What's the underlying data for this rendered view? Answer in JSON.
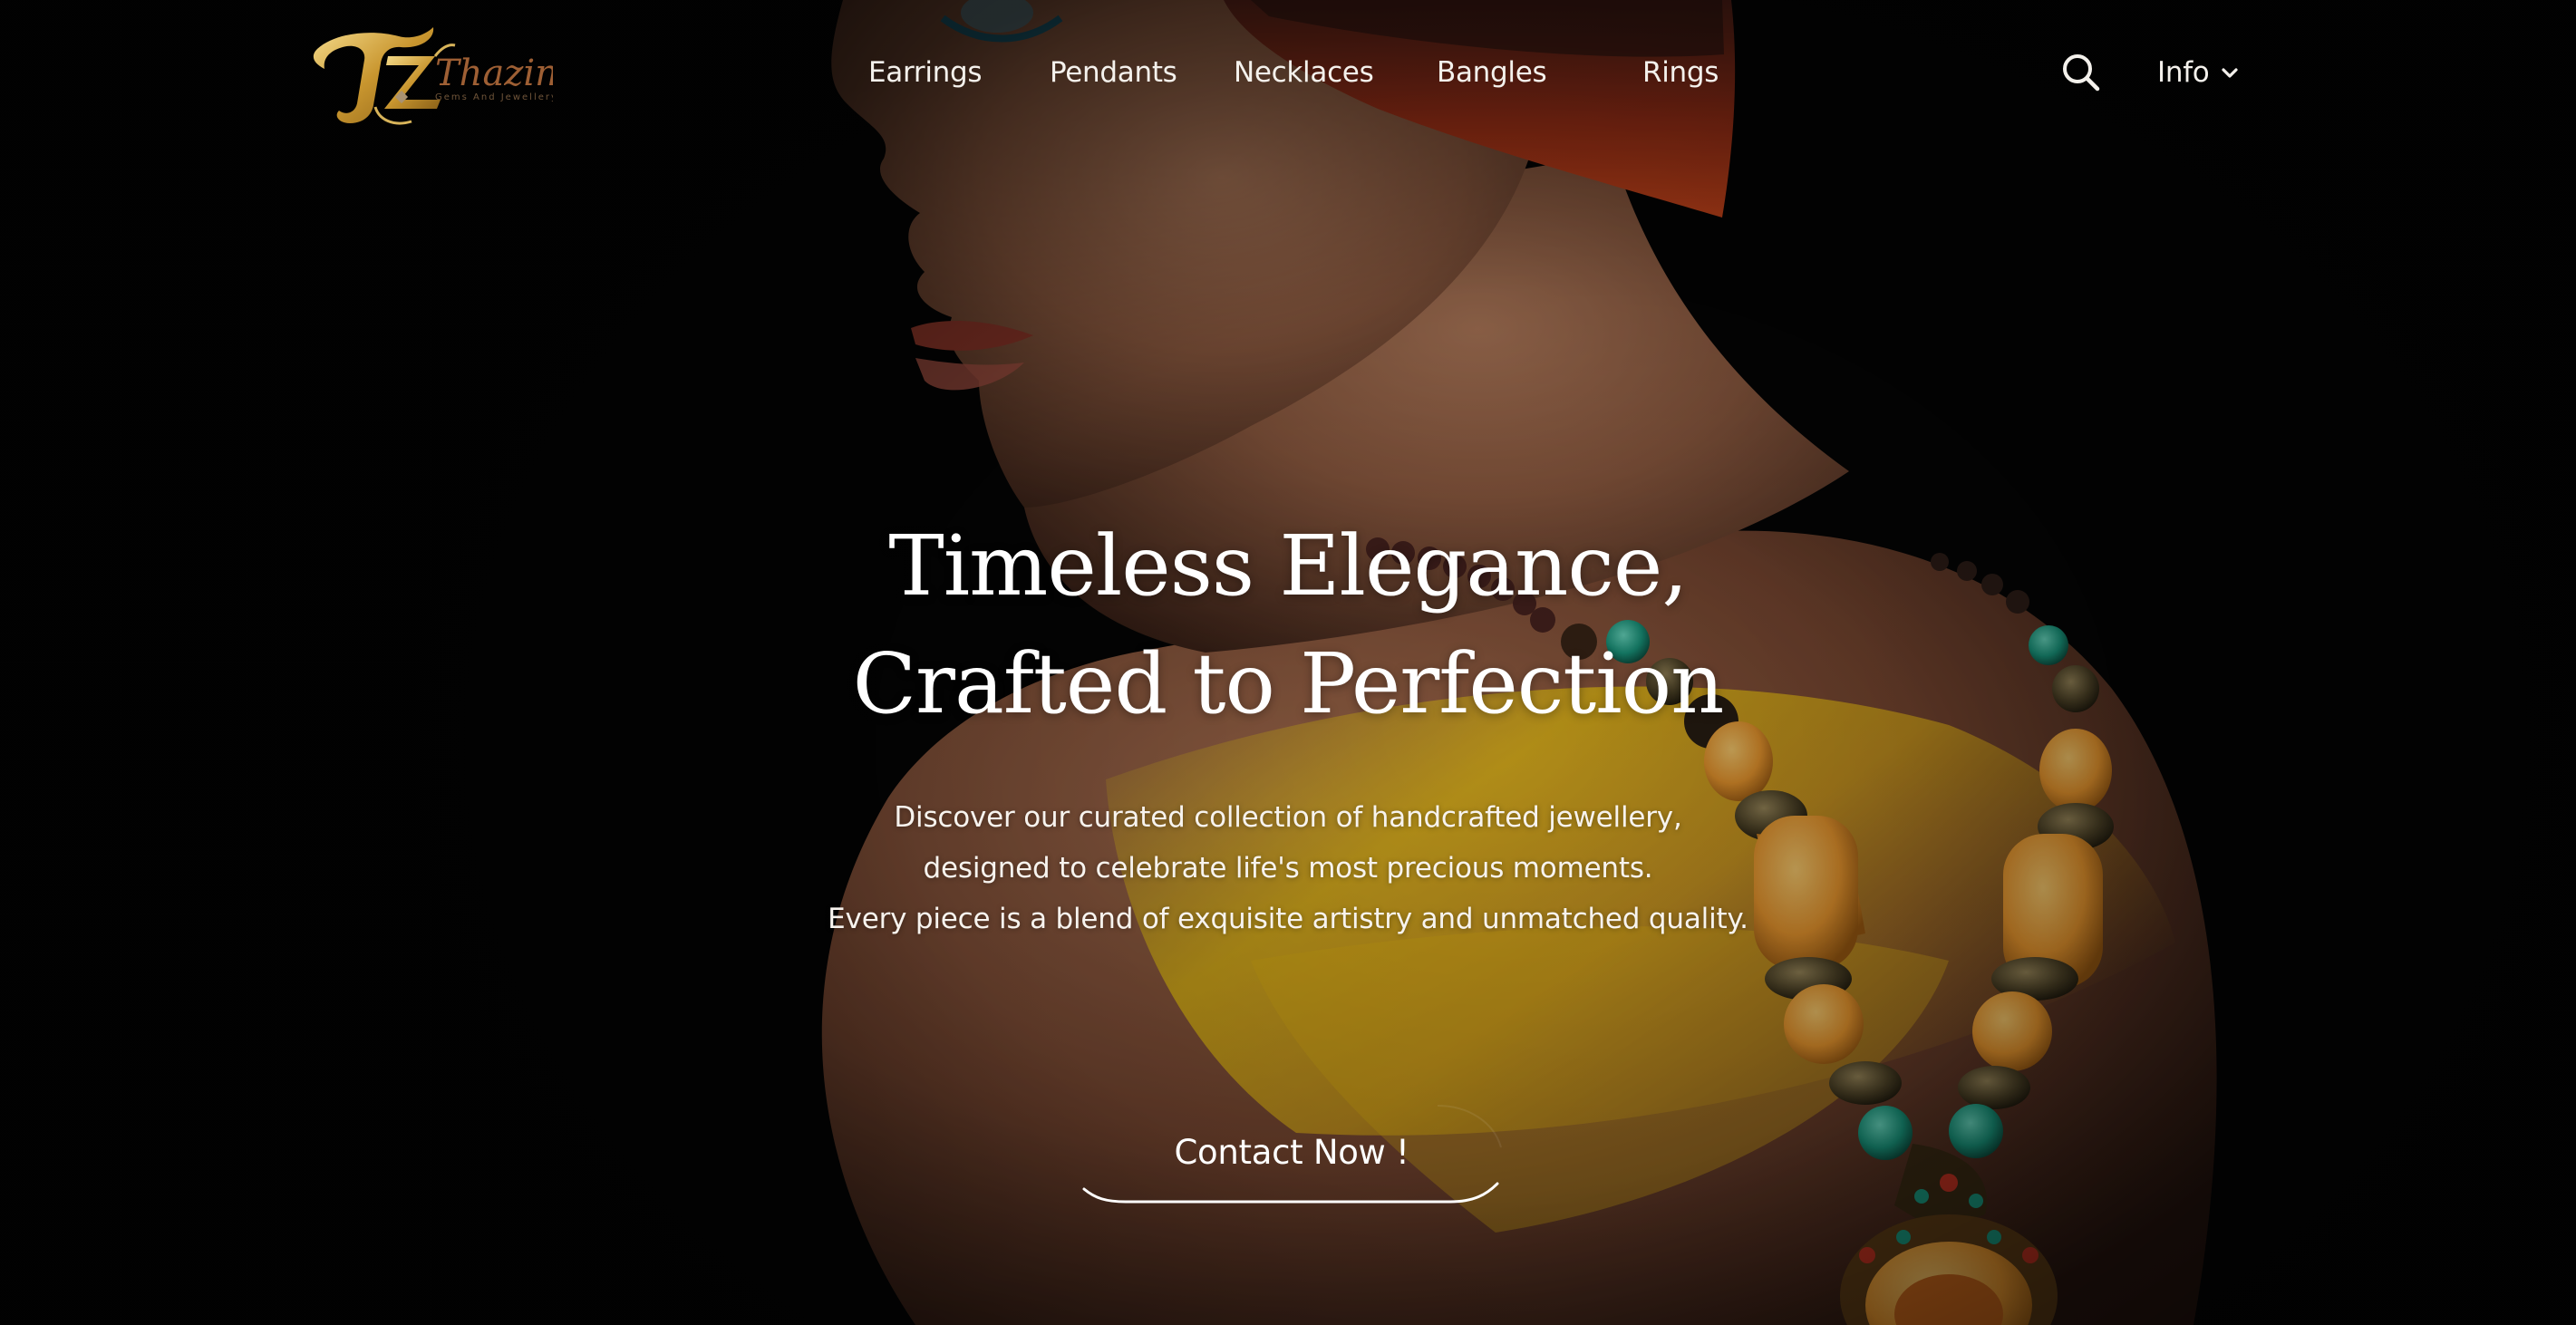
{
  "brand": {
    "name": "Thazin",
    "tagline": "Gems And Jewellery",
    "monogram": "TZ"
  },
  "nav": {
    "items": [
      {
        "label": "Earrings"
      },
      {
        "label": "Pendants"
      },
      {
        "label": "Necklaces"
      },
      {
        "label": "Bangles"
      },
      {
        "label": "Rings"
      }
    ],
    "info_label": "Info",
    "search_icon": "search-icon",
    "info_icon": "chevron-down-icon"
  },
  "hero": {
    "title_line1": "Timeless Elegance,",
    "title_line2": "Crafted to Perfection",
    "desc_line1": "Discover our curated collection of handcrafted jewellery,",
    "desc_line2": "designed to celebrate life's most precious moments.",
    "desc_line3": "Every piece is a blend of exquisite artistry and unmatched quality.",
    "cta_label": "Contact Now !"
  },
  "colors": {
    "background": "#050505",
    "text": "#ffffff",
    "logo_gold": "#d8b45a",
    "headwrap_orange": "#e8461b",
    "amber_bead": "#f0a33a",
    "turquoise_bead": "#1fa08c"
  }
}
